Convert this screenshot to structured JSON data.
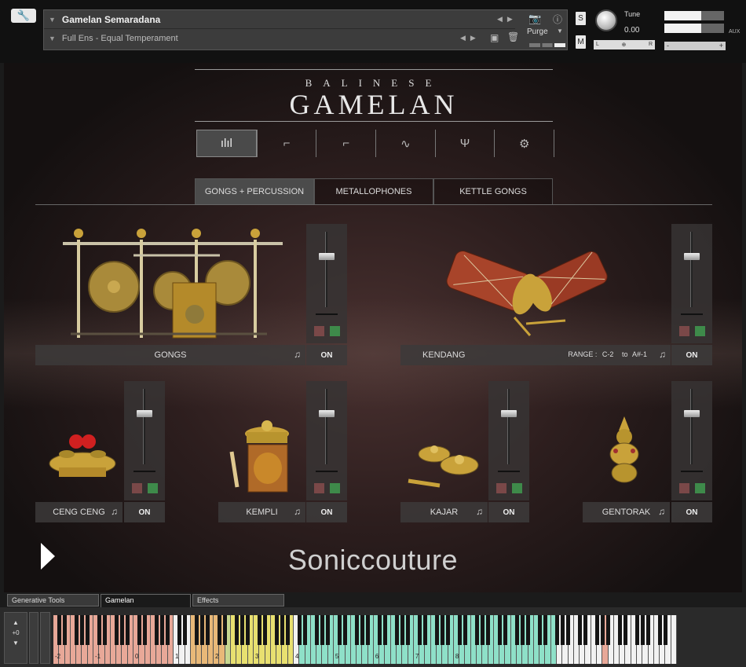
{
  "header": {
    "instrument_name": "Gamelan Semaradana",
    "preset_name": "Full Ens - Equal Temperament",
    "purge_label": "Purge",
    "solo_label": "S",
    "mute_label": "M",
    "tune_label": "Tune",
    "tune_value": "0.00",
    "pan_left": "L",
    "pan_right": "R",
    "aux_label": "AUX",
    "vol_minus": "-",
    "vol_plus": "+"
  },
  "logo": {
    "top": "BALINESE",
    "main": "GAMELAN"
  },
  "toolbar": {
    "icons": [
      "mixer-icon",
      "envelope-icon",
      "attack-icon",
      "filter-icon",
      "tuning-fork-icon",
      "gear-icon"
    ],
    "glyphs": [
      "ılıl",
      "⌐",
      "⌐",
      "∿",
      "Ψ",
      "⚙"
    ],
    "active": 0
  },
  "tabs": [
    "GONGS + PERCUSSION",
    "METALLOPHONES",
    "KETTLE GONGS"
  ],
  "slots": {
    "gongs": {
      "label": "GONGS",
      "on": "ON"
    },
    "kendang": {
      "label": "KENDANG",
      "range_label": "RANGE :",
      "range_from": "C-2",
      "range_to_label": "to",
      "range_to": "A#-1",
      "on": "ON"
    },
    "ceng_ceng": {
      "label": "CENG CENG",
      "on": "ON"
    },
    "kempli": {
      "label": "KEMPLI",
      "on": "ON"
    },
    "kajar": {
      "label": "KAJAR",
      "on": "ON"
    },
    "gentorak": {
      "label": "GENTORAK",
      "on": "ON"
    }
  },
  "brand": "Soniccouture",
  "bottom_tabs": [
    "Generative Tools",
    "Gamelan",
    "Effects"
  ],
  "keyboard": {
    "octave_shift": "+0",
    "octave_labels": [
      "-2",
      "-1",
      "0",
      "1",
      "2",
      "3",
      "4",
      "5",
      "6",
      "7",
      "8"
    ]
  },
  "colors": {
    "accent_green": "#3e8a4a",
    "mute_red": "#7a4848"
  }
}
